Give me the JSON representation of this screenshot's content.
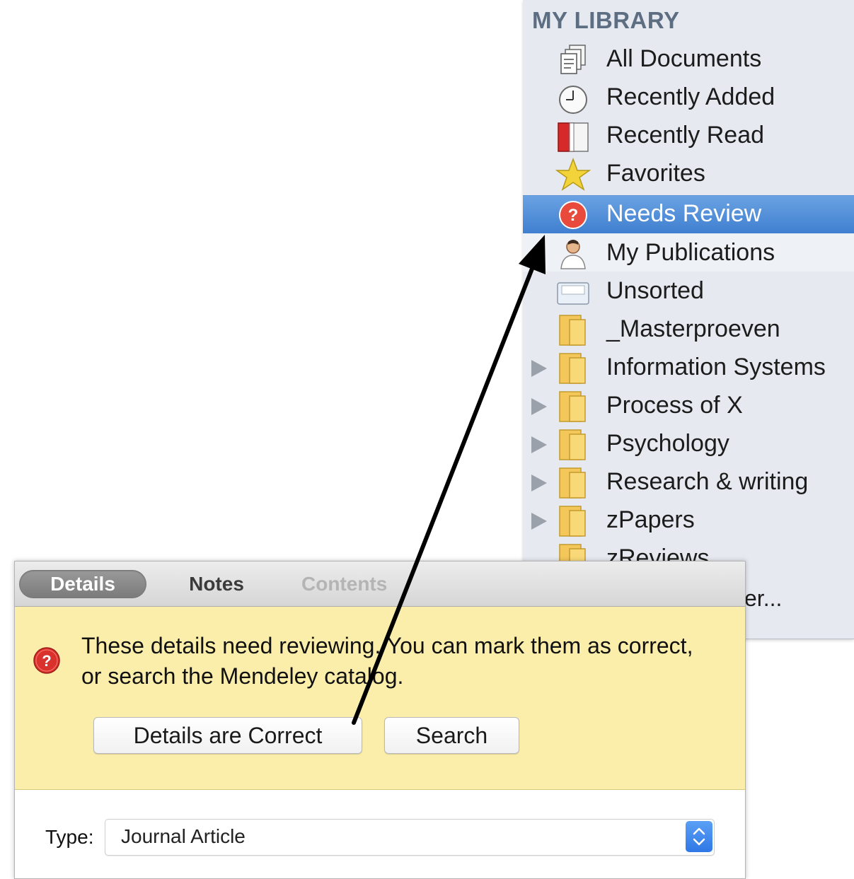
{
  "sidebar": {
    "header": "MY LIBRARY",
    "items": [
      {
        "label": "All Documents",
        "icon": "all-documents-icon"
      },
      {
        "label": "Recently Added",
        "icon": "clock-icon"
      },
      {
        "label": "Recently Read",
        "icon": "book-icon"
      },
      {
        "label": "Favorites",
        "icon": "star-icon"
      },
      {
        "label": "Needs Review",
        "icon": "question-icon",
        "selected": true
      },
      {
        "label": "My Publications",
        "icon": "person-icon"
      },
      {
        "label": "Unsorted",
        "icon": "tray-icon"
      },
      {
        "label": "_Masterproeven",
        "icon": "folder-icon"
      },
      {
        "label": "Information Systems",
        "icon": "folder-icon",
        "expandable": true
      },
      {
        "label": "Process of X",
        "icon": "folder-icon",
        "expandable": true
      },
      {
        "label": "Psychology",
        "icon": "folder-icon",
        "expandable": true
      },
      {
        "label": "Research & writing",
        "icon": "folder-icon",
        "expandable": true
      },
      {
        "label": "zPapers",
        "icon": "folder-icon",
        "expandable": true
      },
      {
        "label": "zReviews",
        "icon": "folder-icon"
      }
    ],
    "partial_item": "er..."
  },
  "panel": {
    "tabs": [
      "Details",
      "Notes",
      "Contents"
    ],
    "review_message": "These details need reviewing. You can mark them as correct, or search the Mendeley catalog.",
    "correct_button": "Details are Correct",
    "search_button": "Search",
    "type_label": "Type:",
    "type_value": "Journal Article"
  },
  "colors": {
    "selection": "#4a88d8",
    "review_background": "#fbeeaa",
    "sidebar_background": "#e6eaf0"
  }
}
